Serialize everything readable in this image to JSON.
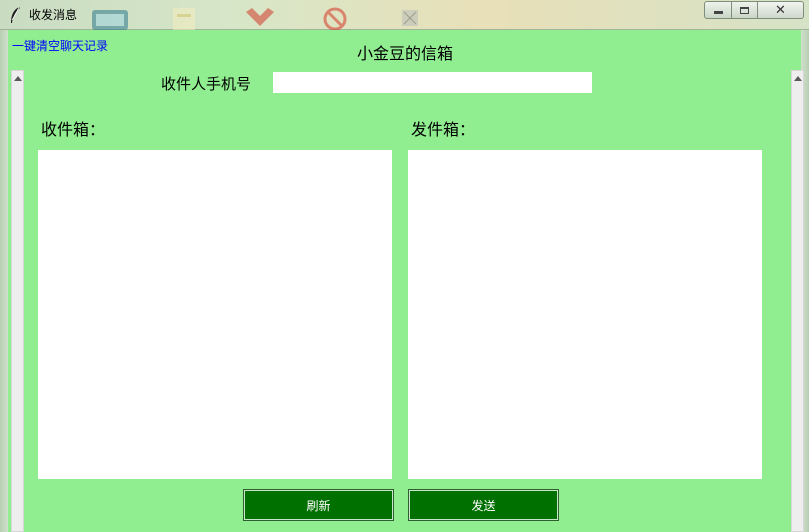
{
  "window": {
    "title": "收发消息",
    "close_glyph": "✕"
  },
  "header": {
    "clear_link": "一键清空聊天记录",
    "page_title": "小金豆的信箱"
  },
  "form": {
    "phone_label": "收件人手机号",
    "phone_value": "",
    "phone_placeholder": ""
  },
  "mailbox": {
    "inbox_label": "收件箱：",
    "outbox_label": "发件箱：",
    "inbox_content": "",
    "outbox_content": ""
  },
  "buttons": {
    "refresh_label": "刷新",
    "send_label": "发送"
  },
  "colors": {
    "client_background": "#90ee90",
    "button_background": "#007000",
    "link_color": "#0000ff"
  }
}
